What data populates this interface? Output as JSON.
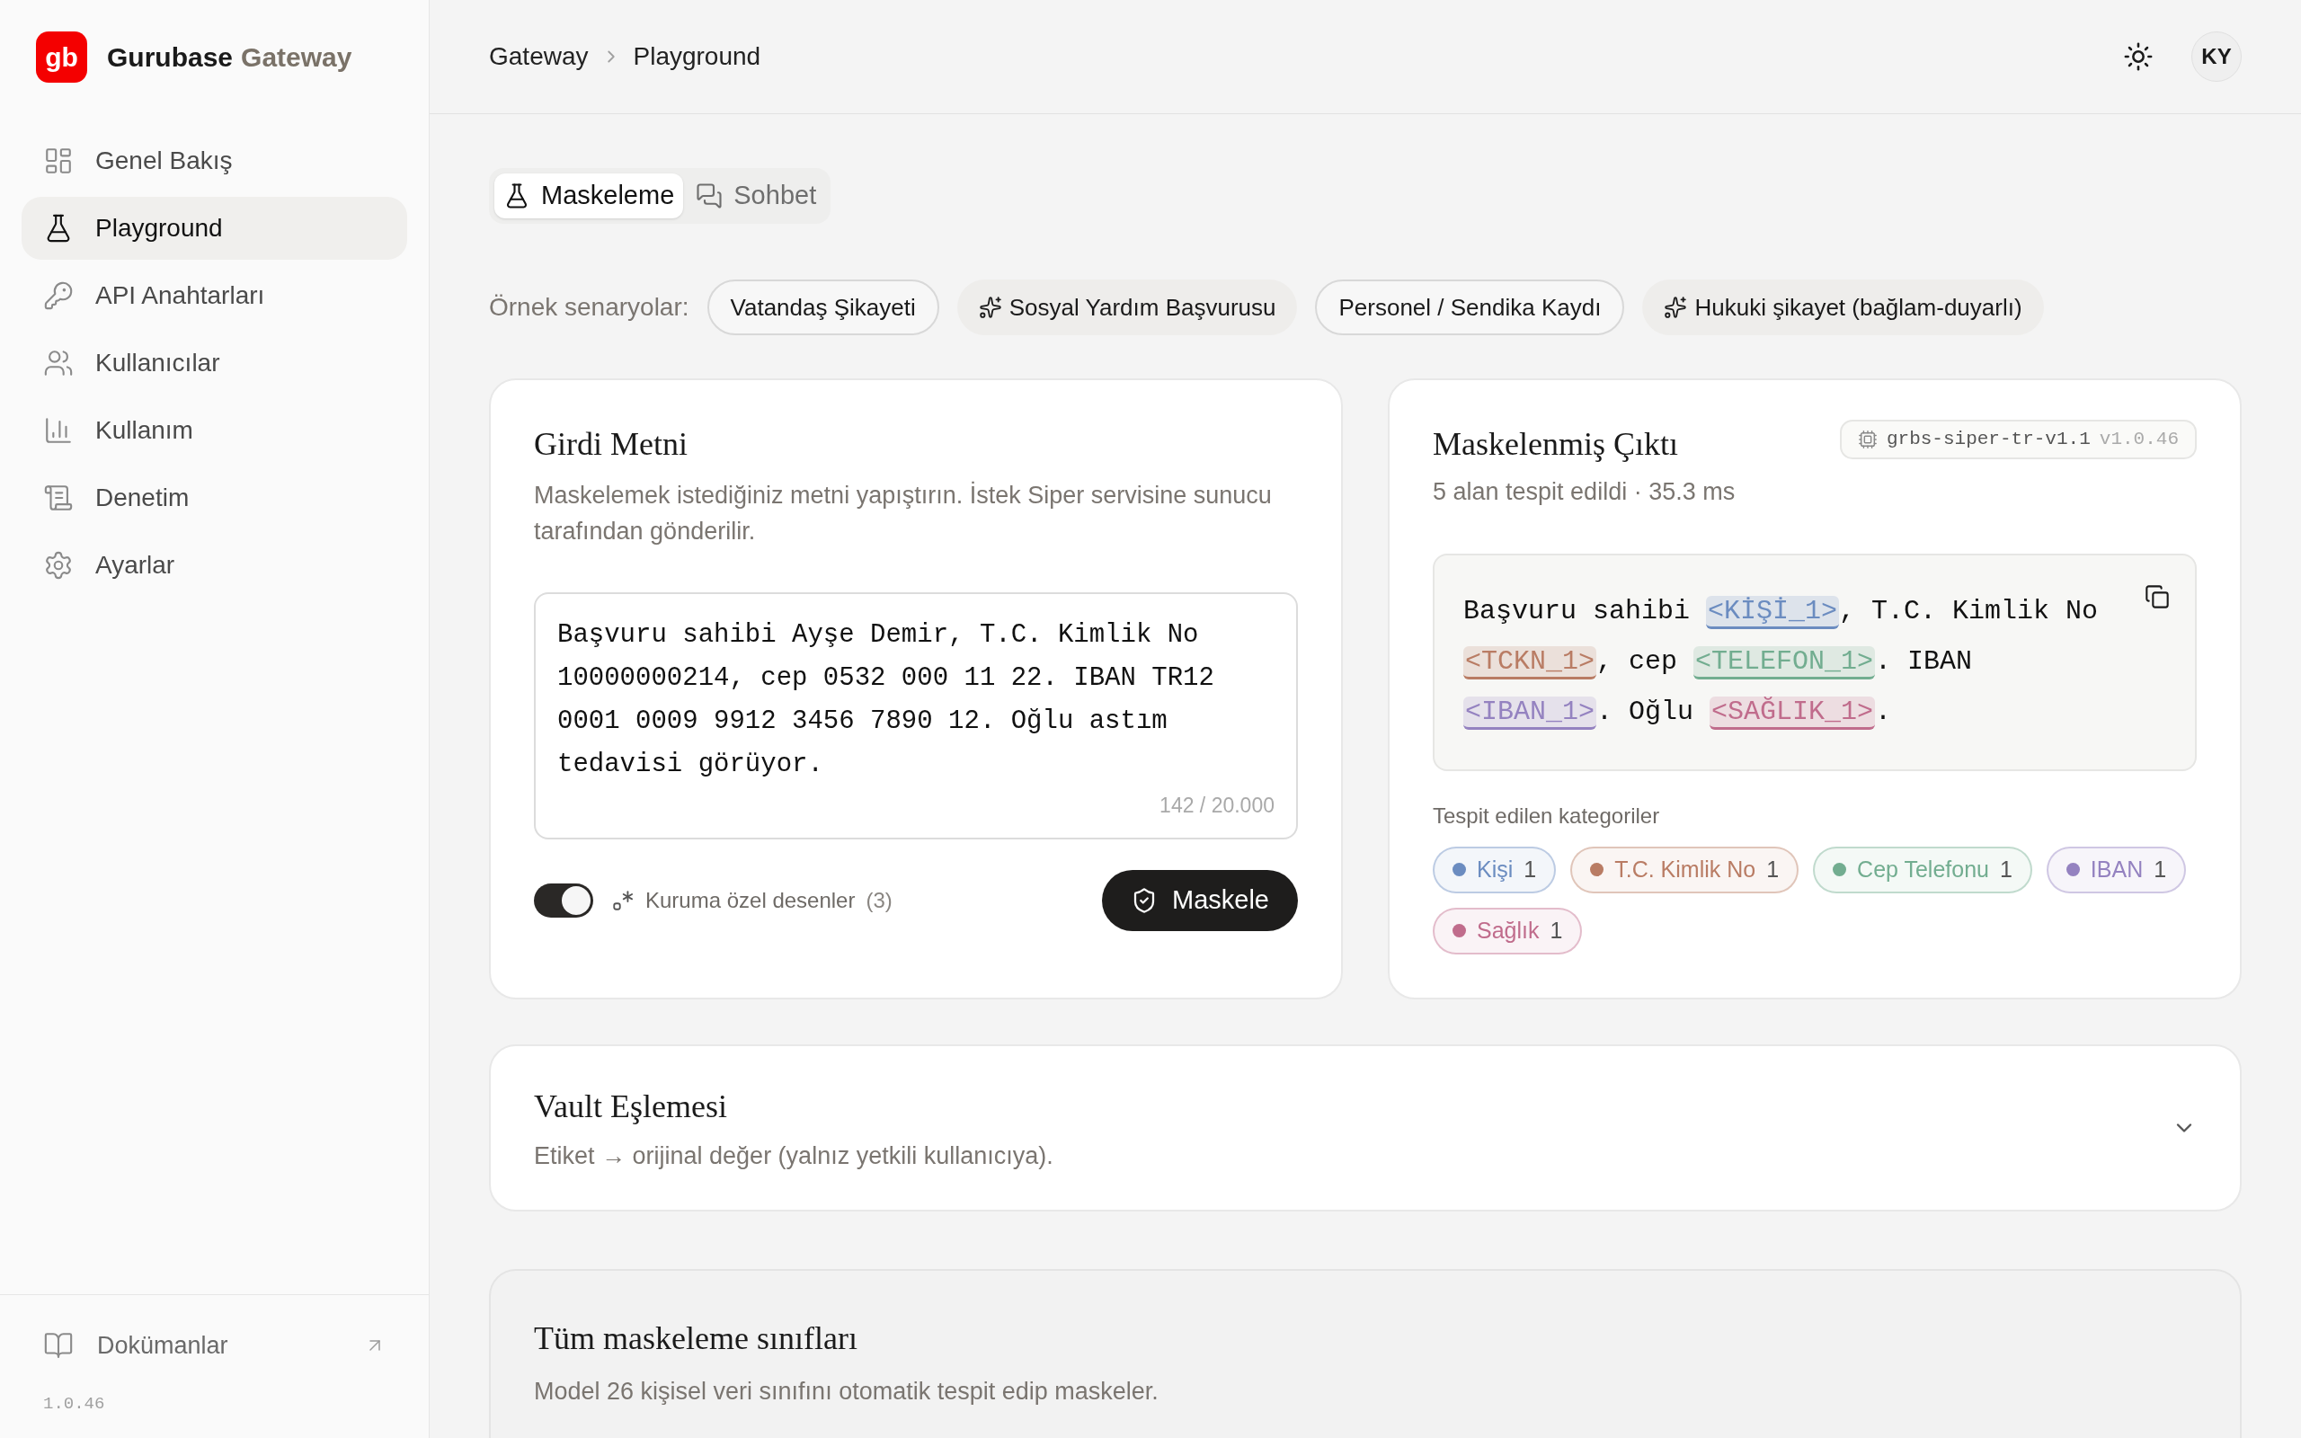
{
  "brand": {
    "logo": "gb",
    "name": "Gurubase",
    "suffix": "Gateway"
  },
  "sidebar": {
    "items": [
      {
        "label": "Genel Bakış",
        "selected": false
      },
      {
        "label": "Playground",
        "selected": true
      },
      {
        "label": "API Anahtarları",
        "selected": false
      },
      {
        "label": "Kullanıcılar",
        "selected": false
      },
      {
        "label": "Kullanım",
        "selected": false
      },
      {
        "label": "Denetim",
        "selected": false
      },
      {
        "label": "Ayarlar",
        "selected": false
      }
    ],
    "docs": "Dokümanlar",
    "version": "1.0.46"
  },
  "breadcrumb": [
    "Gateway",
    "Playground"
  ],
  "avatar": "KY",
  "tabs": [
    {
      "label": "Maskeleme",
      "selected": true
    },
    {
      "label": "Sohbet",
      "selected": false
    }
  ],
  "scenarios": {
    "label": "Örnek senaryolar:",
    "items": [
      {
        "label": "Vatandaş Şikayeti",
        "kind": "plain"
      },
      {
        "label": "Sosyal Yardım Başvurusu",
        "kind": "ai"
      },
      {
        "label": "Personel / Sendika Kaydı",
        "kind": "plain"
      },
      {
        "label": "Hukuki şikayet (bağlam-duyarlı)",
        "kind": "ai"
      }
    ]
  },
  "input": {
    "title": "Girdi Metni",
    "description": "Maskelemek istediğiniz metni yapıştırın. İstek Siper servisine sunucu tarafından gönderilir.",
    "value": "Başvuru sahibi Ayşe Demir, T.C. Kimlik No 10000000214, cep 0532 000 11 22. IBAN TR12 0001 0009 9912 3456 7890 12. Oğlu astım tedavisi görüyor.",
    "counter": "142 / 20.000",
    "toggle_on": true,
    "toggle_label": "Kuruma özel desenler",
    "toggle_count": "(3)",
    "button": "Maskele"
  },
  "output": {
    "title": "Maskelenmiş Çıktı",
    "model": "grbs-siper-tr-v1.1",
    "model_version": "v1.0.46",
    "stats": "5 alan tespit edildi · 35.3 ms",
    "segments": [
      {
        "kind": "text",
        "text": "Başvuru sahibi "
      },
      {
        "kind": "tag",
        "text": "<KİŞİ_1>",
        "color": "#6b8cc0"
      },
      {
        "kind": "text",
        "text": ", T.C. Kimlik No "
      },
      {
        "kind": "tag",
        "text": "<TCKN_1>",
        "color": "#b97c64"
      },
      {
        "kind": "text",
        "text": ", cep "
      },
      {
        "kind": "tag",
        "text": "<TELEFON_1>",
        "color": "#72ad90"
      },
      {
        "kind": "text",
        "text": ". IBAN "
      },
      {
        "kind": "tag",
        "text": "<IBAN_1>",
        "color": "#9482c0"
      },
      {
        "kind": "text",
        "text": ". Oğlu "
      },
      {
        "kind": "tag",
        "text": "<SAĞLIK_1>",
        "color": "#c06c8c"
      },
      {
        "kind": "text",
        "text": "."
      }
    ],
    "categories_label": "Tespit edilen kategoriler",
    "categories": [
      {
        "label": "Kişi",
        "count": "1",
        "color": "#6b8cc0"
      },
      {
        "label": "T.C. Kimlik No",
        "count": "1",
        "color": "#b97c64"
      },
      {
        "label": "Cep Telefonu",
        "count": "1",
        "color": "#72ad90"
      },
      {
        "label": "IBAN",
        "count": "1",
        "color": "#9482c0"
      },
      {
        "label": "Sağlık",
        "count": "1",
        "color": "#c06c8c"
      }
    ]
  },
  "vault": {
    "title": "Vault Eşlemesi",
    "description": "Etiket → orijinal değer (yalnız yetkili kullanıcıya).",
    "expanded": false
  },
  "classes": {
    "title": "Tüm maskeleme sınıfları",
    "description": "Model 26 kişisel veri sınıfını otomatik tespit edip maskeler."
  }
}
